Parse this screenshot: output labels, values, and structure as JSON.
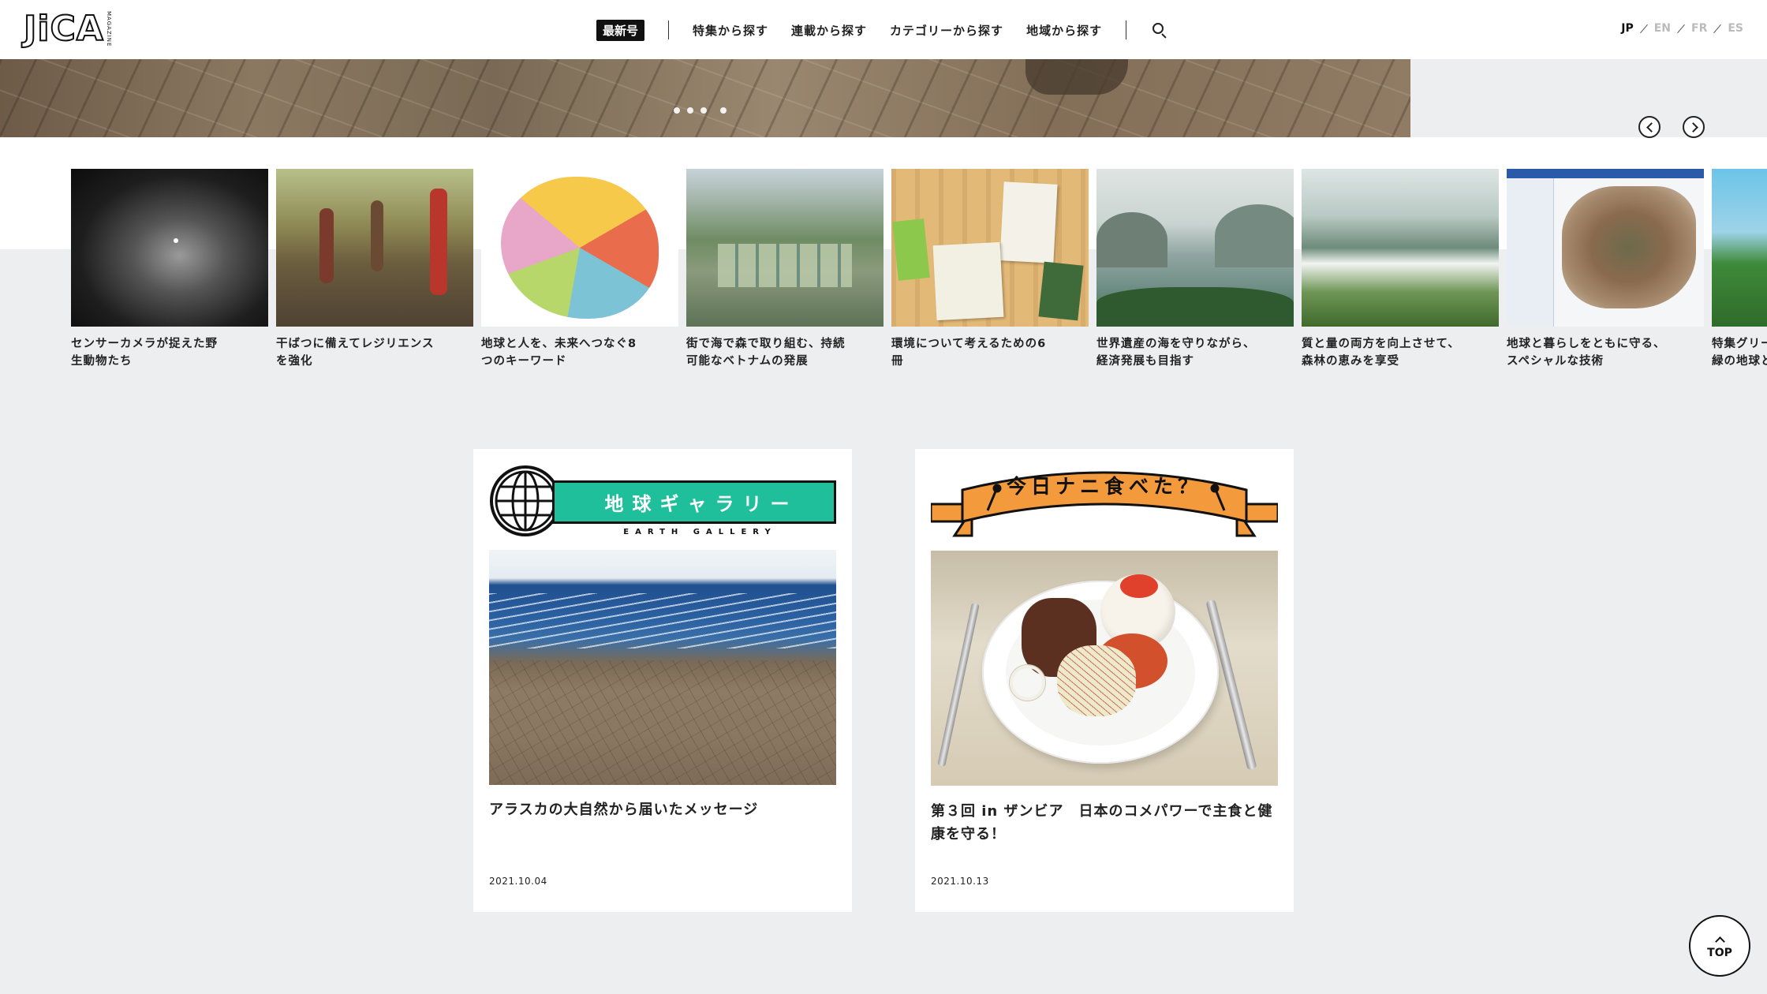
{
  "header": {
    "logo": "JiCA",
    "logo_sub": "MAGAZINE",
    "nav": {
      "latest": "最新号",
      "items": [
        "特集から探す",
        "連載から探す",
        "カテゴリーから探す",
        "地域から探す"
      ]
    },
    "languages": [
      {
        "code": "JP",
        "active": true
      },
      {
        "code": "EN",
        "active": false
      },
      {
        "code": "FR",
        "active": false
      },
      {
        "code": "ES",
        "active": false
      }
    ]
  },
  "hero": {
    "slide_count": 4,
    "active_slide": 0
  },
  "carousel": {
    "items": [
      {
        "title": "センサーカメラが捉えた野生動物たち",
        "line1": "センサーカメラが捉えた野",
        "line2": "生動物たち"
      },
      {
        "title": "干ばつに備えてレジリエンスを強化",
        "line1": "干ばつに備えてレジリエンス",
        "line2": "を強化"
      },
      {
        "title": "地球と人を、未来へつなぐ8つのキーワード",
        "line1": "地球と人を、未来へつなぐ8",
        "line2": "つのキーワード"
      },
      {
        "title": "街で海で森で取り組む、持続可能なベトナムの発展",
        "line1": "街で海で森で取り組む、持続",
        "line2": "可能なベトナムの発展"
      },
      {
        "title": "環境について考えるための6冊",
        "line1": "環境について考えるための6",
        "line2": "冊"
      },
      {
        "title": "世界遺産の海を守りながら、経済発展も目指す",
        "line1": "世界遺産の海を守りながら、",
        "line2": "経済発展も目指す"
      },
      {
        "title": "質と量の両方を向上させて、森林の恵みを享受",
        "line1": "質と量の両方を向上させて、",
        "line2": "森林の恵みを享受"
      },
      {
        "title": "地球と暮らしをともに守る、スペシャルな技術",
        "line1": "地球と暮らしをともに守る、",
        "line2": "スペシャルな技術"
      },
      {
        "title": "特集グリー 緑の地球と",
        "line1": "特集グリー",
        "line2": "緑の地球と"
      }
    ]
  },
  "cards": [
    {
      "series_title": "地球ギャラリー",
      "series_sub": "EARTH GALLERY",
      "title": "アラスカの大自然から届いたメッセージ",
      "date": "2021.10.04"
    },
    {
      "series_title": "今日ナニ食べた？",
      "title": "第３回 in ザンビア　日本のコメパワーで主食と健康を守る！",
      "title_line1": "第３回 in ザンビア　日本のコメパワーで主食と健",
      "title_line2": "康を守る！",
      "date": "2021.10.13"
    }
  ],
  "top_button": "TOP",
  "colors": {
    "earth_gallery_accent": "#1fbf9c",
    "food_banner_accent": "#f39a3c",
    "background": "#eceeef"
  }
}
